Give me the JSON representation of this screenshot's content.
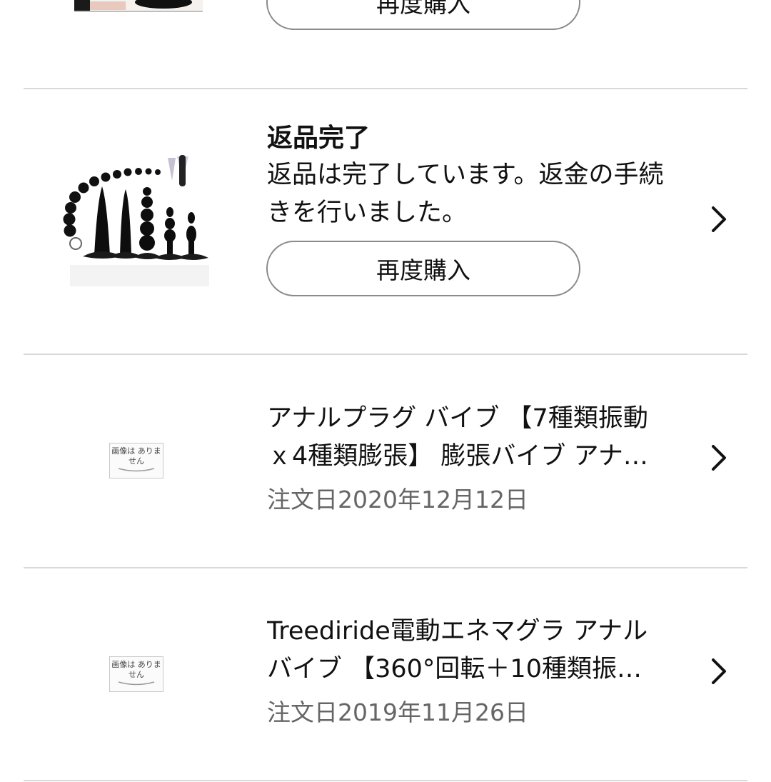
{
  "orders": [
    {
      "rebuy_label": "再度購入"
    },
    {
      "status_title": "返品完了",
      "status_desc": "返品は完了しています。返金の手続きを行いました。",
      "rebuy_label": "再度購入",
      "thumbnail_icon": "product-image"
    },
    {
      "title_line1": "アナルプラグ バイブ 【7種類振動",
      "title_line2": "ｘ4種類膨張】 膨張バイブ アナ…",
      "date": "注文日2020年12月12日",
      "thumbnail_icon": "no-image-placeholder",
      "no_image_text": "画像は ありません"
    },
    {
      "title_line1": "Treediride電動エネマグラ アナル",
      "title_line2": "バイブ 【360°回転＋10種類振…",
      "date": "注文日2019年11月26日",
      "thumbnail_icon": "no-image-placeholder",
      "no_image_text": "画像は ありません"
    }
  ],
  "icons": {
    "chevron": "chevron-right-icon"
  },
  "colors": {
    "divider": "#d9d9d9",
    "button_border": "#8a8a8a",
    "date_text": "#666666"
  }
}
